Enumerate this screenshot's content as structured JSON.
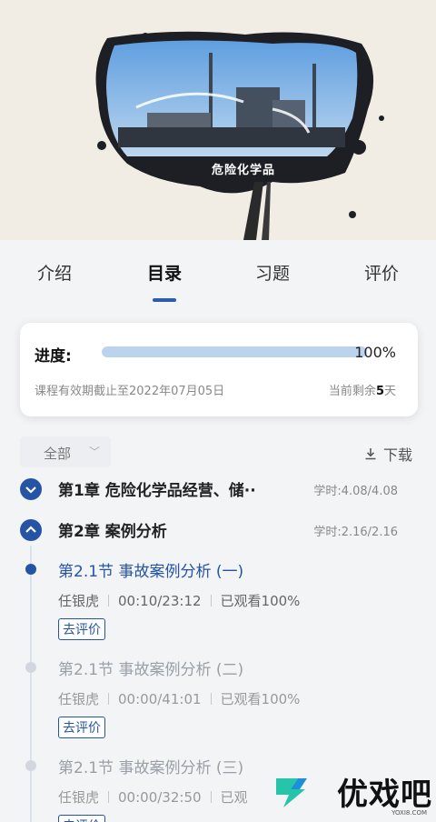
{
  "hero": {
    "caption": "危险化学品"
  },
  "tabs": [
    {
      "label": "介绍"
    },
    {
      "label": "目录"
    },
    {
      "label": "习题"
    },
    {
      "label": "评价"
    }
  ],
  "progress": {
    "label": "进度:",
    "value_text": "100%",
    "fraction": 1.0,
    "valid_text": "课程有效期截止至2022年07月05日",
    "remain_prefix": "当前剩余",
    "remain_days": "5",
    "remain_suffix": "天"
  },
  "filter": {
    "label": "全部",
    "download_label": "下载"
  },
  "chapters": [
    {
      "title": "第1章 危险化学品经营、储··",
      "hours": "学时:4.08/4.08"
    },
    {
      "title": "第2章 案例分析",
      "hours": "学时:2.16/2.16"
    }
  ],
  "sections": [
    {
      "title": "第2.1节  事故案例分析 (一)",
      "teacher": "任银虎",
      "time": "00:10/23:12",
      "watched": "已观看100%",
      "eval_label": "去评价"
    },
    {
      "title": "第2.1节  事故案例分析 (二)",
      "teacher": "任银虎",
      "time": "00:00/41:01",
      "watched": "已观看100%",
      "eval_label": "去评价"
    },
    {
      "title": "第2.1节  事故案例分析 (三)",
      "teacher": "任银虎",
      "time": "00:00/32:50",
      "watched": "已观",
      "eval_label": "去评价"
    }
  ],
  "watermark": {
    "text": "优戏吧",
    "url": "YOXI8.COM"
  },
  "colors": {
    "accent": "#2553a6",
    "progress_fill": "#bcd3ee",
    "background": "#f3f4f6"
  }
}
